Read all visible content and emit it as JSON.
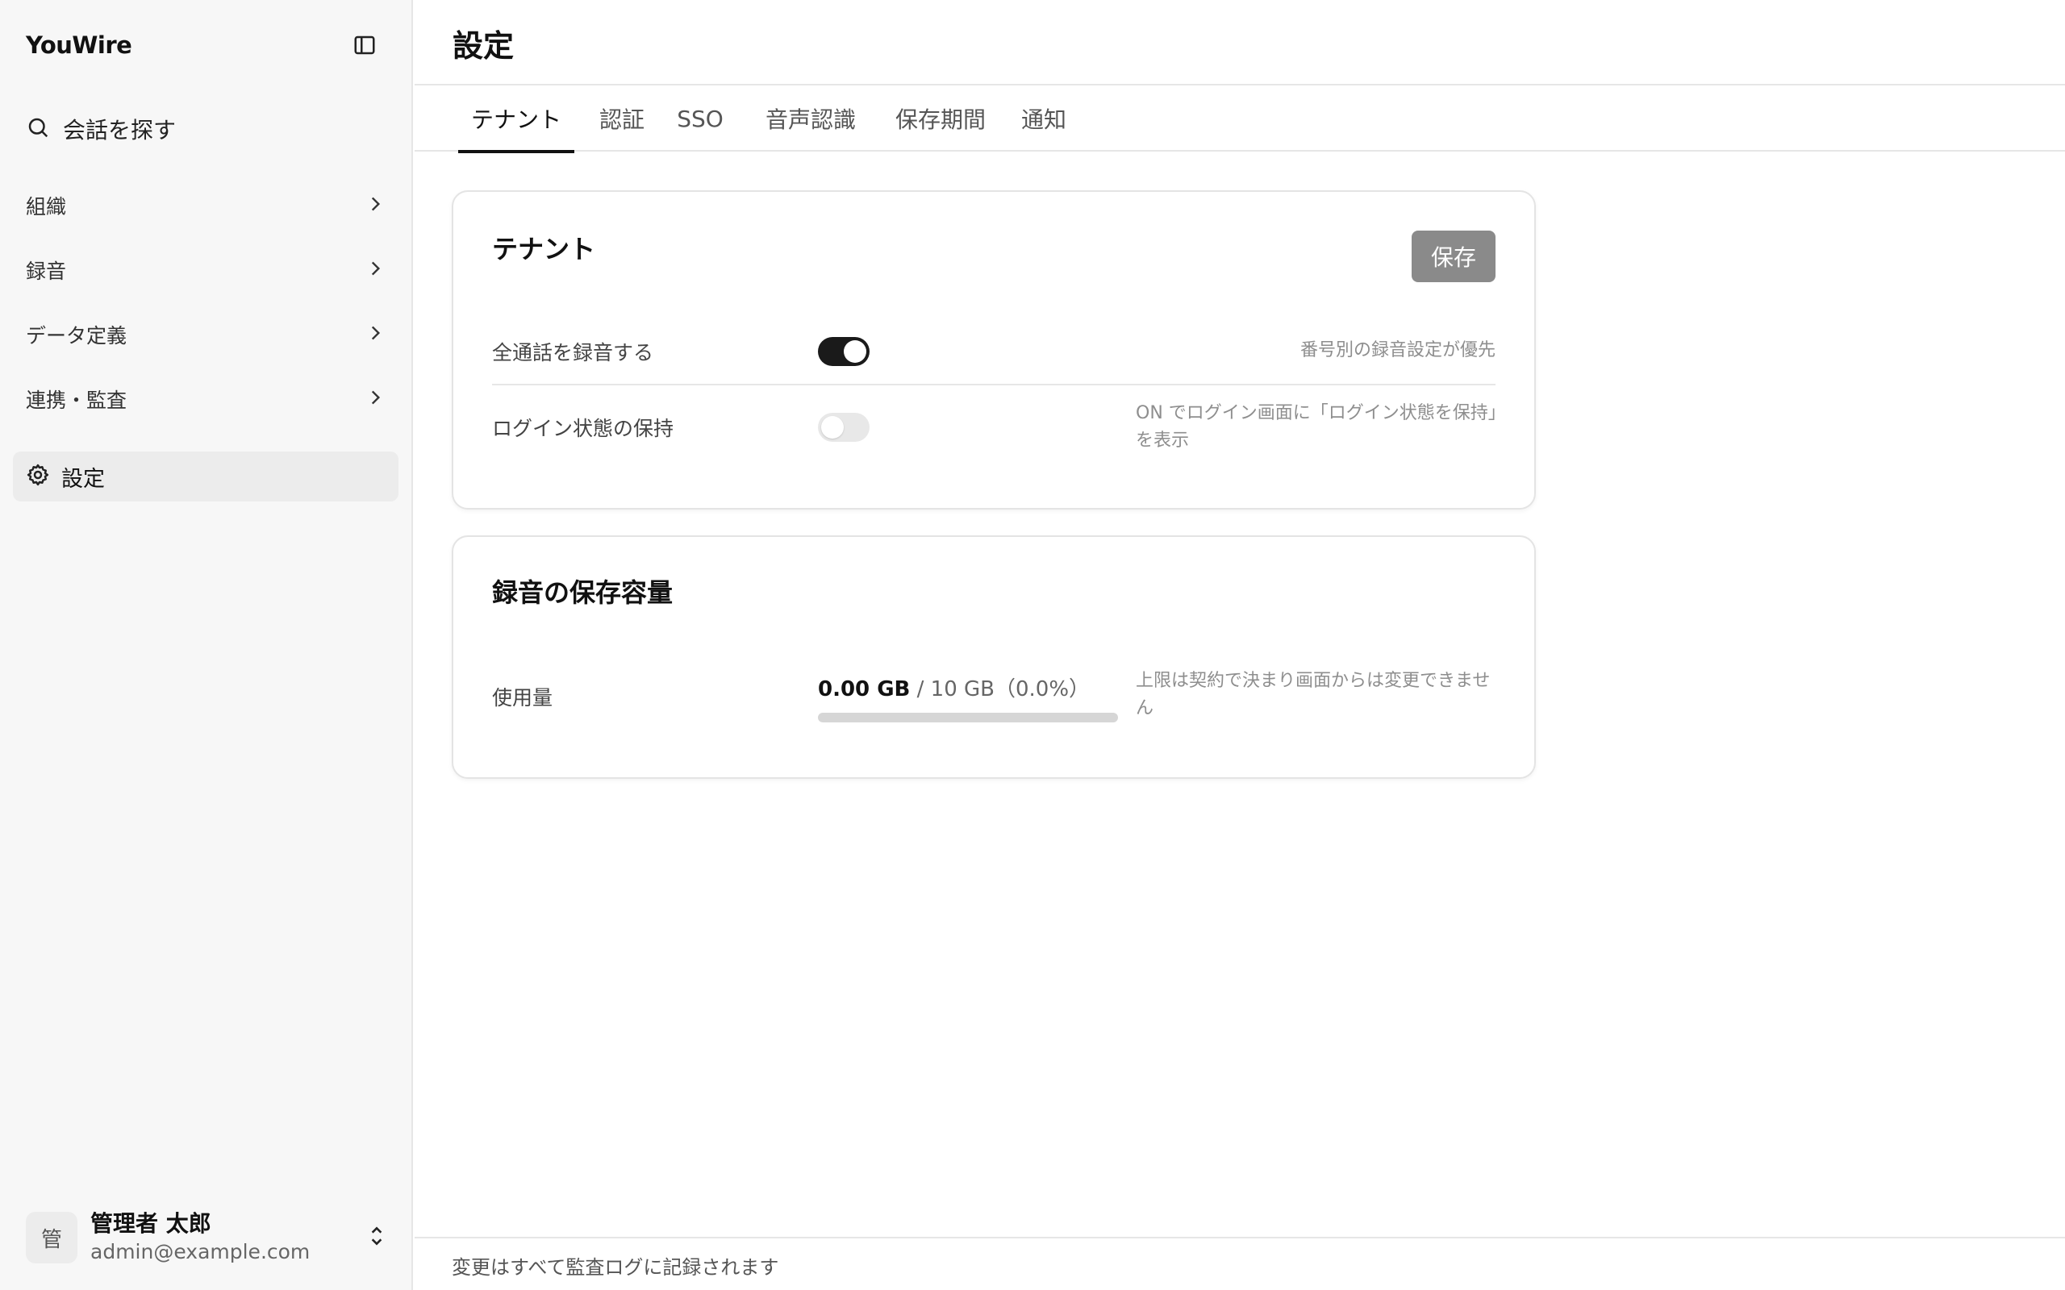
{
  "app": {
    "name": "YouWire"
  },
  "sidebar": {
    "search_label": "会話を探す",
    "items": [
      {
        "label": "組織"
      },
      {
        "label": "録音"
      },
      {
        "label": "データ定義"
      },
      {
        "label": "連携・監査"
      }
    ],
    "active_item": {
      "label": "設定"
    },
    "user": {
      "initial": "管",
      "name": "管理者 太郎",
      "email": "admin@example.com"
    }
  },
  "header": {
    "title": "設定"
  },
  "tabs": [
    {
      "label": "テナント",
      "active": true
    },
    {
      "label": "認証"
    },
    {
      "label": "SSO"
    },
    {
      "label": "音声認識"
    },
    {
      "label": "保存期間"
    },
    {
      "label": "通知"
    }
  ],
  "tenant_card": {
    "title": "テナント",
    "save_label": "保存",
    "rows": [
      {
        "label": "全通話を録音する",
        "enabled": true,
        "hint": "番号別の録音設定が優先"
      },
      {
        "label": "ログイン状態の保持",
        "enabled": false,
        "hint": "ON でログイン画面に「ログイン状態を保持」を表示"
      }
    ]
  },
  "storage_card": {
    "title": "録音の保存容量",
    "usage_label": "使用量",
    "used": "0.00 GB",
    "limit_text": " / 10 GB（0.0%）",
    "usage_fraction": 0.0,
    "hint": "上限は契約で決まり画面からは変更できません"
  },
  "footer": {
    "text": "変更はすべて監査ログに記録されます"
  },
  "colors": {
    "accent": "#1a1a1a",
    "save_button": "#8a8a8a",
    "sidebar_bg": "#f7f7f7"
  }
}
